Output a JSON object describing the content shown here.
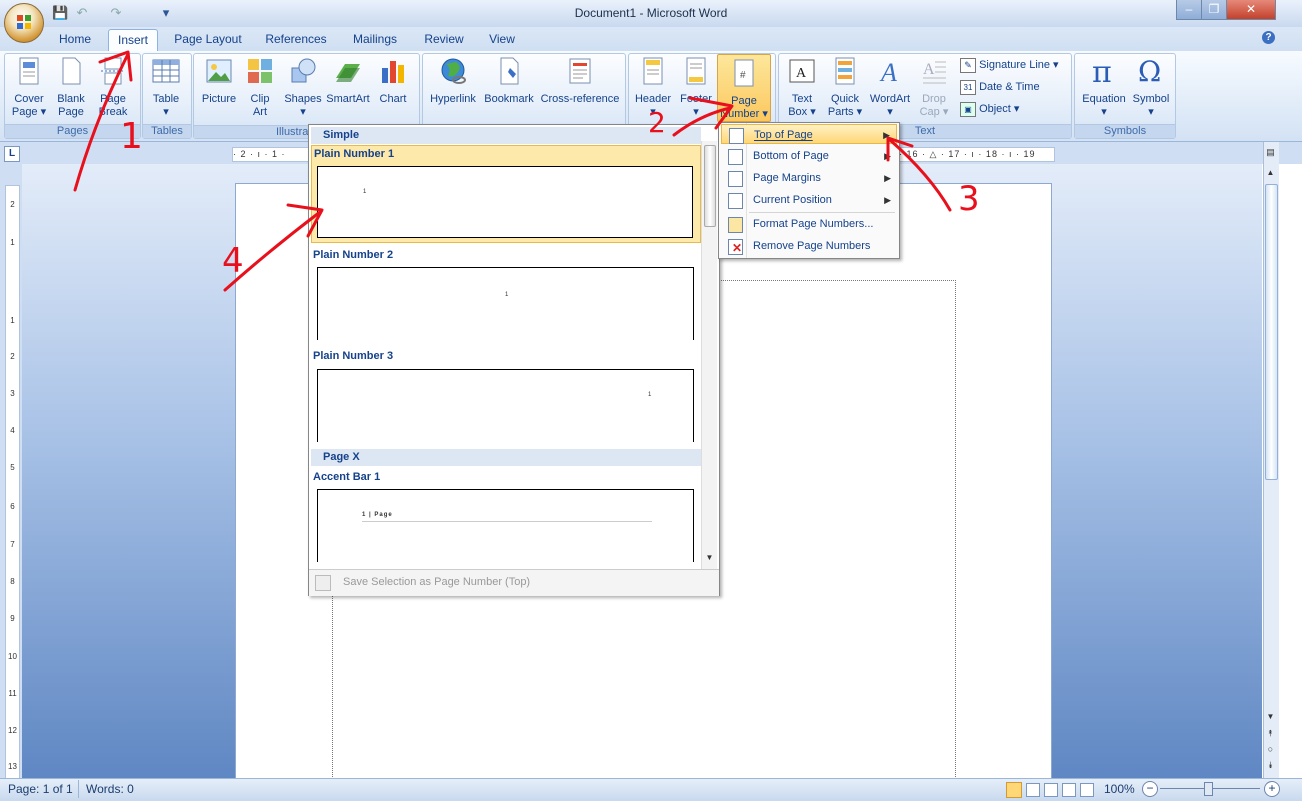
{
  "window": {
    "title": "Document1 - Microsoft Word",
    "controls": {
      "minimize": "–",
      "maximize": "❐",
      "close": "✕"
    }
  },
  "quick_access": {
    "save": "💾",
    "undo": "↶",
    "redo": "↷",
    "customize": "▾"
  },
  "tabs": [
    "Home",
    "Insert",
    "Page Layout",
    "References",
    "Mailings",
    "Review",
    "View"
  ],
  "active_tab": "Insert",
  "help": "?",
  "ribbon": {
    "pages": {
      "label": "Pages",
      "cover": "Cover",
      "cover2": "Page ▾",
      "blank": "Blank",
      "blank2": "Page",
      "break": "Page",
      "break2": "Break"
    },
    "tables": {
      "label": "Tables",
      "table": "Table",
      "table2": "▾"
    },
    "illustrations": {
      "label": "Illustra",
      "picture": "Picture",
      "clipart": "Clip",
      "clipart2": "Art",
      "shapes": "Shapes",
      "shapes2": "▾",
      "smartart": "SmartArt",
      "chart": "Chart"
    },
    "links": {
      "hyperlink": "Hyperlink",
      "bookmark": "Bookmark",
      "crossref": "Cross-reference"
    },
    "header_footer": {
      "header": "Header",
      "header2": "▾",
      "footer": "Footer",
      "footer2": "▾",
      "pagenumber": "Page",
      "pagenumber2": "Number ▾"
    },
    "text": {
      "label": "Text",
      "textbox": "Text",
      "textbox2": "Box ▾",
      "quickparts": "Quick",
      "quickparts2": "Parts ▾",
      "wordart": "WordArt",
      "wordart2": "▾",
      "dropcap": "Drop",
      "dropcap2": "Cap ▾",
      "signature": "Signature Line ▾",
      "datetime": "Date & Time",
      "object": "Object ▾"
    },
    "symbols": {
      "label": "Symbols",
      "equation": "Equation",
      "equation2": "▾",
      "symbol": "Symbol",
      "symbol2": "▾"
    }
  },
  "ruler": {
    "left": "· 2 · ı · 1 ·",
    "right": "· 16 · △ · 17 · ı · 18 · ı · 19"
  },
  "vruler_labels": [
    "2",
    "1",
    "1",
    "2",
    "3",
    "4",
    "5",
    "6",
    "7",
    "8",
    "9",
    "10",
    "11",
    "12",
    "13"
  ],
  "gallery": {
    "section1": "Simple",
    "items": [
      {
        "label": "Plain Number 1",
        "sample": "1"
      },
      {
        "label": "Plain Number 2",
        "sample": "1"
      },
      {
        "label": "Plain Number 3",
        "sample": "1"
      }
    ],
    "section2": "Page X",
    "item4": {
      "label": "Accent Bar 1",
      "sample": "1 | Page"
    },
    "footer": "Save Selection as Page Number (Top)"
  },
  "submenu": {
    "items": [
      "Top of Page",
      "Bottom of Page",
      "Page Margins",
      "Current Position",
      "Format Page Numbers...",
      "Remove Page Numbers"
    ]
  },
  "status": {
    "page": "Page: 1 of 1",
    "words": "Words: 0",
    "zoom": "100%",
    "minus": "−",
    "plus": "+"
  },
  "annotations": {
    "n1": "1",
    "n2": "2",
    "n3": "3",
    "n4": "4"
  },
  "colors": {
    "accent": "#15428b",
    "highlight": "#fbc85e",
    "annotation": "#e8101c"
  }
}
